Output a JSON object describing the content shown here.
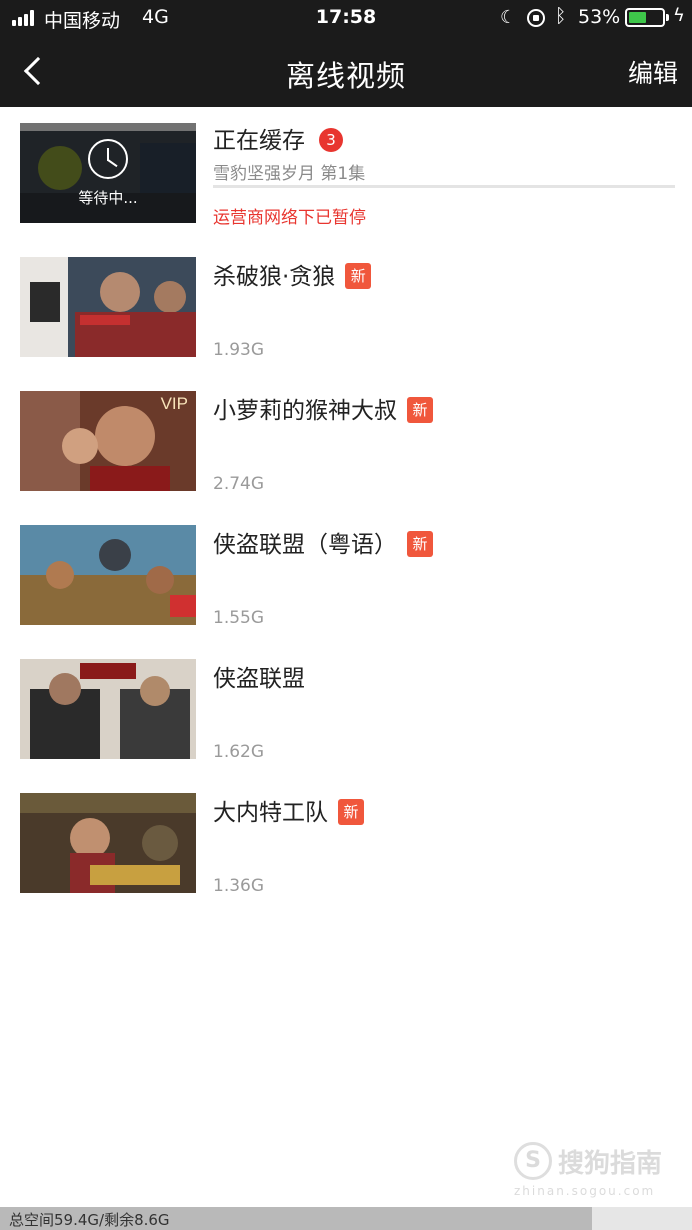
{
  "status_bar": {
    "carrier": "中国移动",
    "network": "4G",
    "time": "17:58",
    "battery_percent": "53%",
    "battery_level": 0.53
  },
  "nav": {
    "back_icon": "chevron-left-icon",
    "title": "离线视频",
    "edit_label": "编辑"
  },
  "caching": {
    "title": "正在缓存",
    "count": "3",
    "overlay_text": "等待中...",
    "current_episode": "雪豹坚强岁月 第1集",
    "status": "运营商网络下已暂停"
  },
  "items": [
    {
      "name": "杀破狼·贪狼",
      "badge": "新",
      "size": "1.93G"
    },
    {
      "name": "小萝莉的猴神大叔",
      "badge": "新",
      "size": "2.74G",
      "tag": "VIP"
    },
    {
      "name": "侠盗联盟（粤语）",
      "badge": "新",
      "size": "1.55G"
    },
    {
      "name": "侠盗联盟",
      "size": "1.62G"
    },
    {
      "name": "大内特工队",
      "badge": "新",
      "size": "1.36G"
    }
  ],
  "footer": {
    "storage_text": "总空间59.4G/剩余8.6G",
    "used_fraction": 0.855
  },
  "colors": {
    "nav_bg": "#1b1b1b",
    "badge_red": "#f0573c",
    "alert_red": "#e8352f",
    "battery_green": "#3ec64a"
  }
}
